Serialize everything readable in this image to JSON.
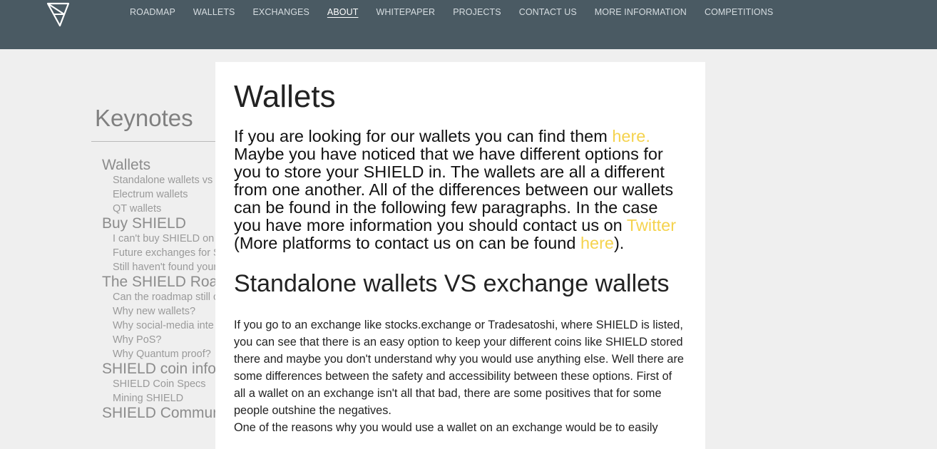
{
  "header": {
    "nav": [
      {
        "label": "ROADMAP",
        "active": false
      },
      {
        "label": "WALLETS",
        "active": false
      },
      {
        "label": "EXCHANGES",
        "active": false
      },
      {
        "label": "ABOUT",
        "active": true
      },
      {
        "label": "WHITEPAPER",
        "active": false
      },
      {
        "label": "PROJECTS",
        "active": false
      },
      {
        "label": "CONTACT US",
        "active": false
      },
      {
        "label": "MORE INFORMATION",
        "active": false
      },
      {
        "label": "COMPETITIONS",
        "active": false
      }
    ],
    "logo_icon": "shield-logo-icon",
    "bg_color": "#4a5a63"
  },
  "sidebar": {
    "title": "Keynotes",
    "target_icon": "crosshair-icon",
    "sections": [
      {
        "label": "Wallets",
        "items": [
          "Standalone wallets vs",
          "Electrum wallets",
          "QT wallets"
        ]
      },
      {
        "label": "Buy SHIELD",
        "items": [
          "I can't buy SHIELD on",
          "Future exchanges for S",
          "Still haven't found your"
        ]
      },
      {
        "label": "The SHIELD Roadmap",
        "items": [
          "Can the roadmap still c",
          "Why new wallets?",
          "Why social-media inte",
          "Why PoS?",
          "Why Quantum proof?"
        ]
      },
      {
        "label": "SHIELD coin info",
        "items": [
          "SHIELD Coin Specs",
          "Mining SHIELD"
        ]
      },
      {
        "label": "SHIELD Community",
        "items": []
      }
    ]
  },
  "main": {
    "title": "Wallets",
    "intro": {
      "part1": "If you are looking for our wallets you can find them ",
      "link1": "here.",
      "part2": " Maybe you have noticed that we have different options for you to store your SHIELD in. The wallets are all a different from one another. All of the differences between our wallets can be found in the following few paragraphs. In the case you have more information you should contact us on ",
      "link2": "Twitter",
      "part3": " (More platforms to contact us on can be found ",
      "link3": "here",
      "part4": ")."
    },
    "subtitle": "Standalone wallets VS exchange wallets",
    "paragraph1": "If you go to an exchange like stocks.exchange or Tradesatoshi, where SHIELD is listed, you can see that there is an easy option to keep your different coins like SHIELD stored there and maybe you don't understand why you would use anything else. Well there are some differences between the safety and accessibility between these options. First of all a wallet on an exchange isn't all that bad, there are some positives that for some people outshine the negatives.",
    "paragraph2": "One of the reasons why you would use a wallet on an exchange would be to easily",
    "link_color": "#f5d34e"
  }
}
